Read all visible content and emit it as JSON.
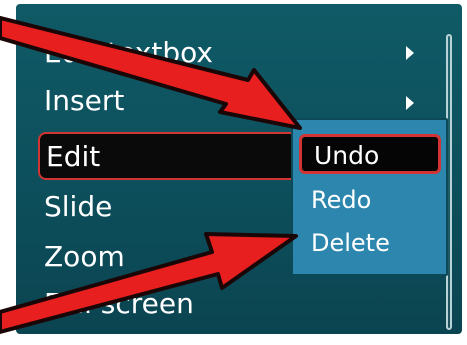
{
  "menu": {
    "items": [
      {
        "label": "Edit textbox"
      },
      {
        "label": "Insert"
      },
      {
        "label": "Edit"
      },
      {
        "label": "Slide"
      },
      {
        "label": "Zoom"
      },
      {
        "label": "Full screen"
      }
    ]
  },
  "submenu": {
    "items": [
      {
        "label": "Undo"
      },
      {
        "label": "Redo"
      },
      {
        "label": "Delete"
      }
    ]
  },
  "colors": {
    "menu_background": "#0f5a66",
    "submenu_background": "#2d86ad",
    "highlight_border": "#d23333",
    "callout_arrow": "#e81f1f"
  },
  "icons": [
    "submenu-arrow-icon",
    "scrollbar",
    "callout-arrow"
  ]
}
